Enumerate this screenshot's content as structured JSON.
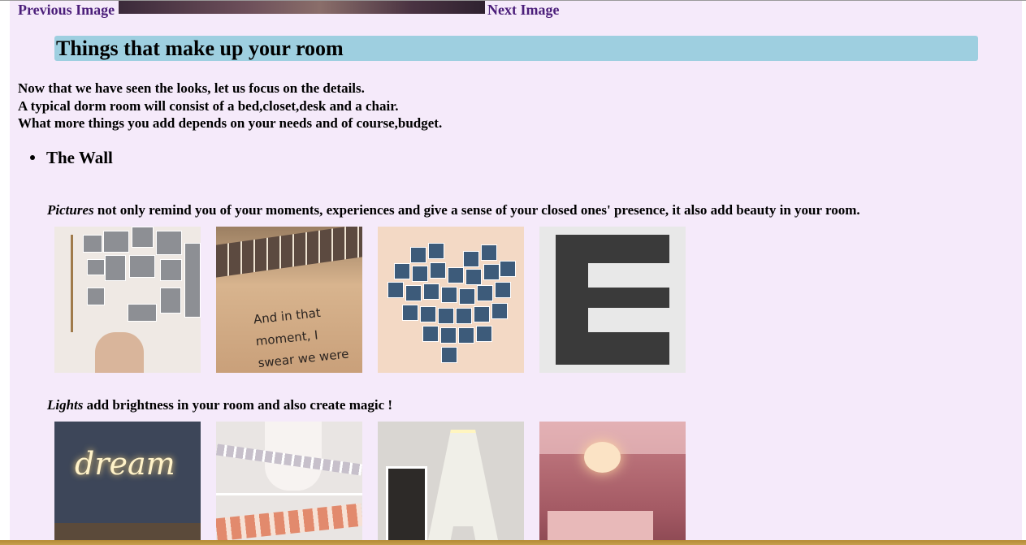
{
  "nav": {
    "previous_label": "Previous Image",
    "next_label": "Next Image"
  },
  "section": {
    "title": "Things that make up your room",
    "intro": [
      "Now that we have seen the looks, let us focus on the details.",
      "A typical dorm room will consist of a bed,closet,desk and a chair.",
      "What more things you add depends on your needs and of course,budget."
    ],
    "bullet": "The Wall",
    "pictures": {
      "lead": "Pictures",
      "text": " not only remind you of your moments, experiences and give a sense of your closed ones' presence, it also add beauty in your room."
    },
    "lights": {
      "lead": "Lights",
      "text": " add brightness in your room and also create magic !"
    },
    "thumb_text": {
      "moment_quote": "And in that moment, I swear we were infinite.",
      "dream_word": "dream"
    }
  },
  "colors": {
    "page_background": "#f5eafa",
    "title_background": "#9ecfe0",
    "link_color": "#4b1e7a"
  }
}
